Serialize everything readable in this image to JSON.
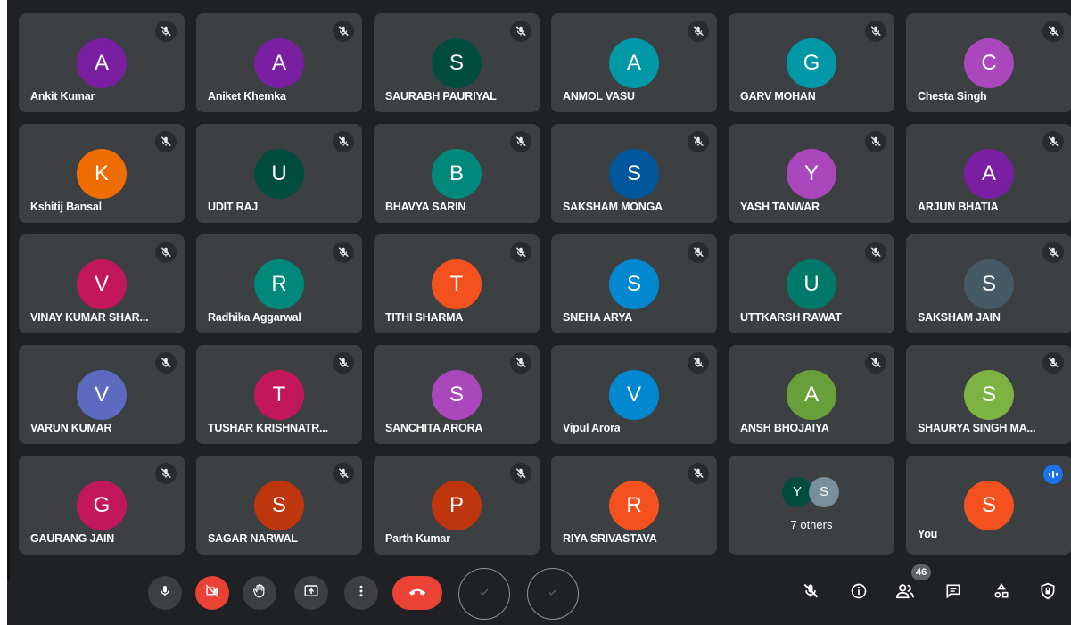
{
  "participants": [
    {
      "name": "Ankit Kumar",
      "initial": "A",
      "color": "#7b1fa2"
    },
    {
      "name": "Aniket Khemka",
      "initial": "A",
      "color": "#7b1fa2"
    },
    {
      "name": "SAURABH PAURIYAL",
      "initial": "S",
      "color": "#004d40"
    },
    {
      "name": "ANMOL VASU",
      "initial": "A",
      "color": "#0097a7"
    },
    {
      "name": "GARV MOHAN",
      "initial": "G",
      "color": "#0097a7"
    },
    {
      "name": "Chesta Singh",
      "initial": "C",
      "color": "#ab47bc"
    },
    {
      "name": "Kshitij Bansal",
      "initial": "K",
      "color": "#ef6c00"
    },
    {
      "name": "UDIT RAJ",
      "initial": "U",
      "color": "#004d40"
    },
    {
      "name": "BHAVYA SARIN",
      "initial": "B",
      "color": "#00897b"
    },
    {
      "name": "SAKSHAM MONGA",
      "initial": "S",
      "color": "#01579b"
    },
    {
      "name": "YASH TANWAR",
      "initial": "Y",
      "color": "#ab47bc"
    },
    {
      "name": "ARJUN BHATIA",
      "initial": "A",
      "color": "#7b1fa2"
    },
    {
      "name": "VINAY KUMAR SHAR...",
      "initial": "V",
      "color": "#c2185b"
    },
    {
      "name": "Radhika Aggarwal",
      "initial": "R",
      "color": "#00897b"
    },
    {
      "name": "TITHI SHARMA",
      "initial": "T",
      "color": "#f4511e"
    },
    {
      "name": "SNEHA ARYA",
      "initial": "S",
      "color": "#0288d1"
    },
    {
      "name": "UTTKARSH RAWAT",
      "initial": "U",
      "color": "#00796b"
    },
    {
      "name": "SAKSHAM JAIN",
      "initial": "S",
      "color": "#455a64"
    },
    {
      "name": "VARUN KUMAR",
      "initial": "V",
      "color": "#5c6bc0"
    },
    {
      "name": "TUSHAR KRISHNATR...",
      "initial": "T",
      "color": "#c2185b"
    },
    {
      "name": "SANCHITA ARORA",
      "initial": "S",
      "color": "#ab47bc"
    },
    {
      "name": "Vipul Arora",
      "initial": "V",
      "color": "#0288d1"
    },
    {
      "name": "ANSH BHOJAIYA",
      "initial": "A",
      "color": "#689f38"
    },
    {
      "name": "SHAURYA SINGH MA...",
      "initial": "S",
      "color": "#7cb342"
    },
    {
      "name": "GAURANG JAIN",
      "initial": "G",
      "color": "#c2185b"
    },
    {
      "name": "SAGAR NARWAL",
      "initial": "S",
      "color": "#bf360c"
    },
    {
      "name": "Parth Kumar",
      "initial": "P",
      "color": "#bf360c"
    },
    {
      "name": "RIYA SRIVASTAVA",
      "initial": "R",
      "color": "#f4511e"
    }
  ],
  "others": {
    "label": "7 others",
    "avatars": [
      {
        "initial": "Y",
        "color": "#004d40"
      },
      {
        "initial": "S",
        "color": "#78909c"
      }
    ]
  },
  "self": {
    "name": "You",
    "initial": "S",
    "color": "#f4511e"
  },
  "people_count": "46",
  "controls": {
    "left": [
      "mic-icon",
      "camera-off-icon",
      "raise-hand-icon",
      "present-icon",
      "more-options-icon",
      "end-call-icon"
    ],
    "right": [
      "mute-all-icon",
      "info-icon",
      "people-icon",
      "chat-icon",
      "activities-icon",
      "host-controls-icon"
    ]
  }
}
